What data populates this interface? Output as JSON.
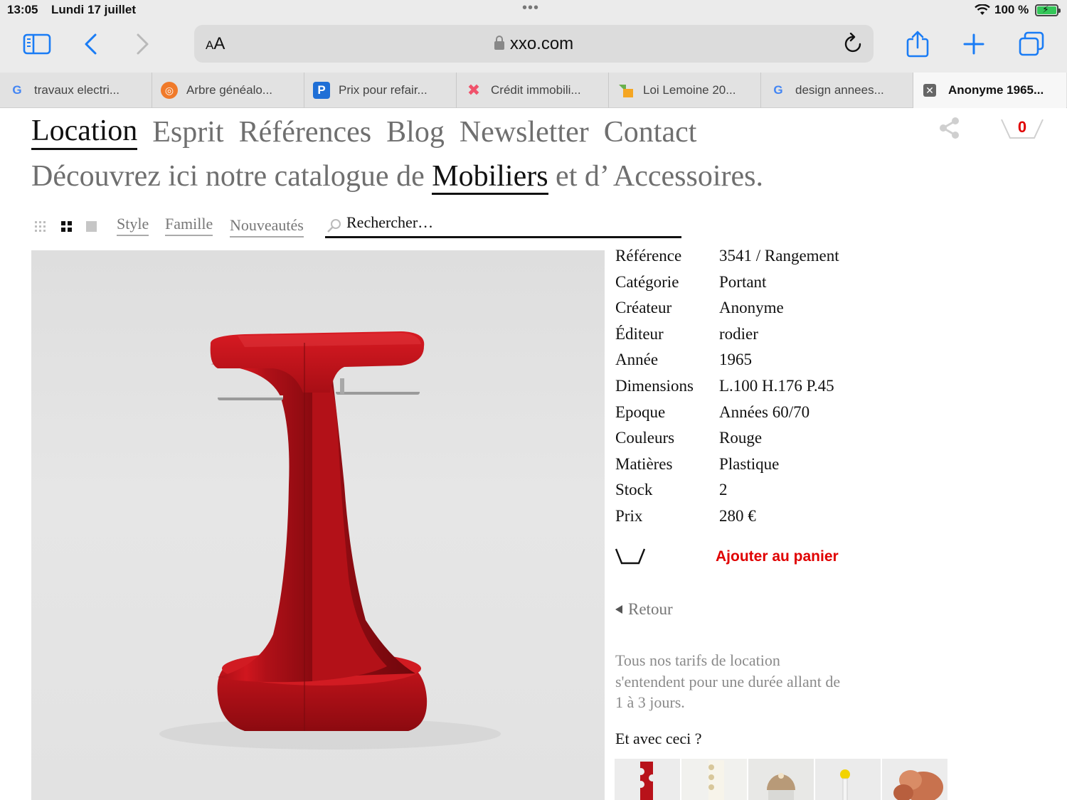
{
  "status_bar": {
    "time": "13:05",
    "date": "Lundi 17 juillet",
    "battery": "100 %"
  },
  "toolbar": {
    "aa_label_big": "A",
    "aa_label_small": "A",
    "url": "xxo.com",
    "icons": [
      "sidebar-icon",
      "back-icon",
      "forward-icon",
      "reload-icon",
      "share-icon",
      "new-tab-icon",
      "tabs-overview-icon"
    ]
  },
  "tabs": [
    {
      "title": "travaux electri...",
      "favicon": "G",
      "favicon_color": "#4285f4"
    },
    {
      "title": "Arbre généalo...",
      "favicon": "◎",
      "favicon_color": "#f07a2a"
    },
    {
      "title": "Prix pour refair...",
      "favicon": "P",
      "favicon_color": "#1f6fd6"
    },
    {
      "title": "Crédit immobili...",
      "favicon": "✕",
      "favicon_color": "#f0526b"
    },
    {
      "title": "Loi Lemoine 20...",
      "favicon": "▲",
      "favicon_color": "#6ab04c"
    },
    {
      "title": "design annees...",
      "favicon": "G",
      "favicon_color": "#4285f4"
    },
    {
      "title": "Anonyme 1965...",
      "favicon": "close",
      "active": true
    }
  ],
  "site": {
    "nav": [
      "Location",
      "Esprit",
      "Références",
      "Blog",
      "Newsletter",
      "Contact"
    ],
    "active_nav": "Location",
    "cart_count": "0",
    "tagline_before": "Découvrez ici notre catalogue de ",
    "tagline_strong": "Mobiliers",
    "tagline_after": " et d’ Accessoires."
  },
  "filters": {
    "style": "Style",
    "famille": "Famille",
    "nouveautes": "Nouveautés",
    "search_placeholder": "Rechercher…"
  },
  "product": {
    "specs": [
      {
        "label": "Référence",
        "value": "3541 / Rangement"
      },
      {
        "label": "Catégorie",
        "value": "Portant"
      },
      {
        "label": "Créateur",
        "value": "Anonyme"
      },
      {
        "label": "Éditeur",
        "value": "rodier"
      },
      {
        "label": "Année",
        "value": "1965"
      },
      {
        "label": "Dimensions",
        "value": "L.100 H.176 P.45"
      },
      {
        "label": "Epoque",
        "value": "Années 60/70"
      },
      {
        "label": "Couleurs",
        "value": "Rouge"
      },
      {
        "label": "Matières",
        "value": "Plastique"
      },
      {
        "label": "Stock",
        "value": "2"
      },
      {
        "label": "Prix",
        "value": "280 €"
      }
    ],
    "add_to_cart": "Ajouter au panier",
    "back": "Retour",
    "rental_note": "Tous nos tarifs de location s'entendent pour une durée allant de 1 à 3 jours.",
    "also_title": "Et avec ceci ?"
  },
  "colors": {
    "accent_red": "#e00000",
    "product_red": "#c8141c",
    "nav_grey": "#6f6f6f"
  }
}
